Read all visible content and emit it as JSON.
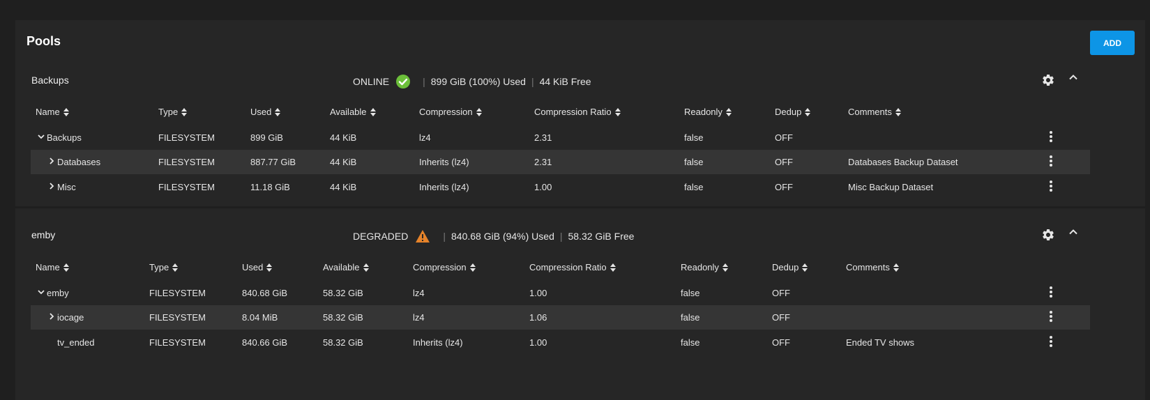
{
  "page": {
    "title": "Pools",
    "add_label": "ADD"
  },
  "columns": [
    "Name",
    "Type",
    "Used",
    "Available",
    "Compression",
    "Compression Ratio",
    "Readonly",
    "Dedup",
    "Comments"
  ],
  "pools": [
    {
      "name": "Backups",
      "status": "ONLINE",
      "status_icon": "check-circle-icon",
      "used": "899 GiB (100%) Used",
      "free": "44 KiB Free",
      "rows": [
        {
          "expander": "expanded",
          "name": "Backups",
          "type": "FILESYSTEM",
          "used": "899 GiB",
          "available": "44 KiB",
          "compression": "lz4",
          "ratio": "2.31",
          "readonly": "false",
          "dedup": "OFF",
          "comments": ""
        },
        {
          "expander": "collapsed",
          "name": "Databases",
          "type": "FILESYSTEM",
          "used": "887.77 GiB",
          "available": "44 KiB",
          "compression": "Inherits (lz4)",
          "ratio": "2.31",
          "readonly": "false",
          "dedup": "OFF",
          "comments": "Databases Backup Dataset"
        },
        {
          "expander": "collapsed",
          "name": "Misc",
          "type": "FILESYSTEM",
          "used": "11.18 GiB",
          "available": "44 KiB",
          "compression": "Inherits (lz4)",
          "ratio": "1.00",
          "readonly": "false",
          "dedup": "OFF",
          "comments": "Misc Backup Dataset"
        }
      ]
    },
    {
      "name": "emby",
      "status": "DEGRADED",
      "status_icon": "warning-triangle-icon",
      "used": "840.68 GiB (94%) Used",
      "free": "58.32 GiB Free",
      "rows": [
        {
          "expander": "expanded",
          "name": "emby",
          "type": "FILESYSTEM",
          "used": "840.68 GiB",
          "available": "58.32 GiB",
          "compression": "lz4",
          "ratio": "1.00",
          "readonly": "false",
          "dedup": "OFF",
          "comments": ""
        },
        {
          "expander": "collapsed",
          "name": "iocage",
          "type": "FILESYSTEM",
          "used": "8.04 MiB",
          "available": "58.32 GiB",
          "compression": "lz4",
          "ratio": "1.06",
          "readonly": "false",
          "dedup": "OFF",
          "comments": ""
        },
        {
          "expander": "none",
          "name": "tv_ended",
          "type": "FILESYSTEM",
          "used": "840.66 GiB",
          "available": "58.32 GiB",
          "compression": "Inherits (lz4)",
          "ratio": "1.00",
          "readonly": "false",
          "dedup": "OFF",
          "comments": "Ended TV shows"
        }
      ]
    }
  ],
  "colors": {
    "accent": "#0d95e6",
    "online": "#6cbf3a",
    "degraded": "#e6832a",
    "row_highlight": "#353535"
  }
}
